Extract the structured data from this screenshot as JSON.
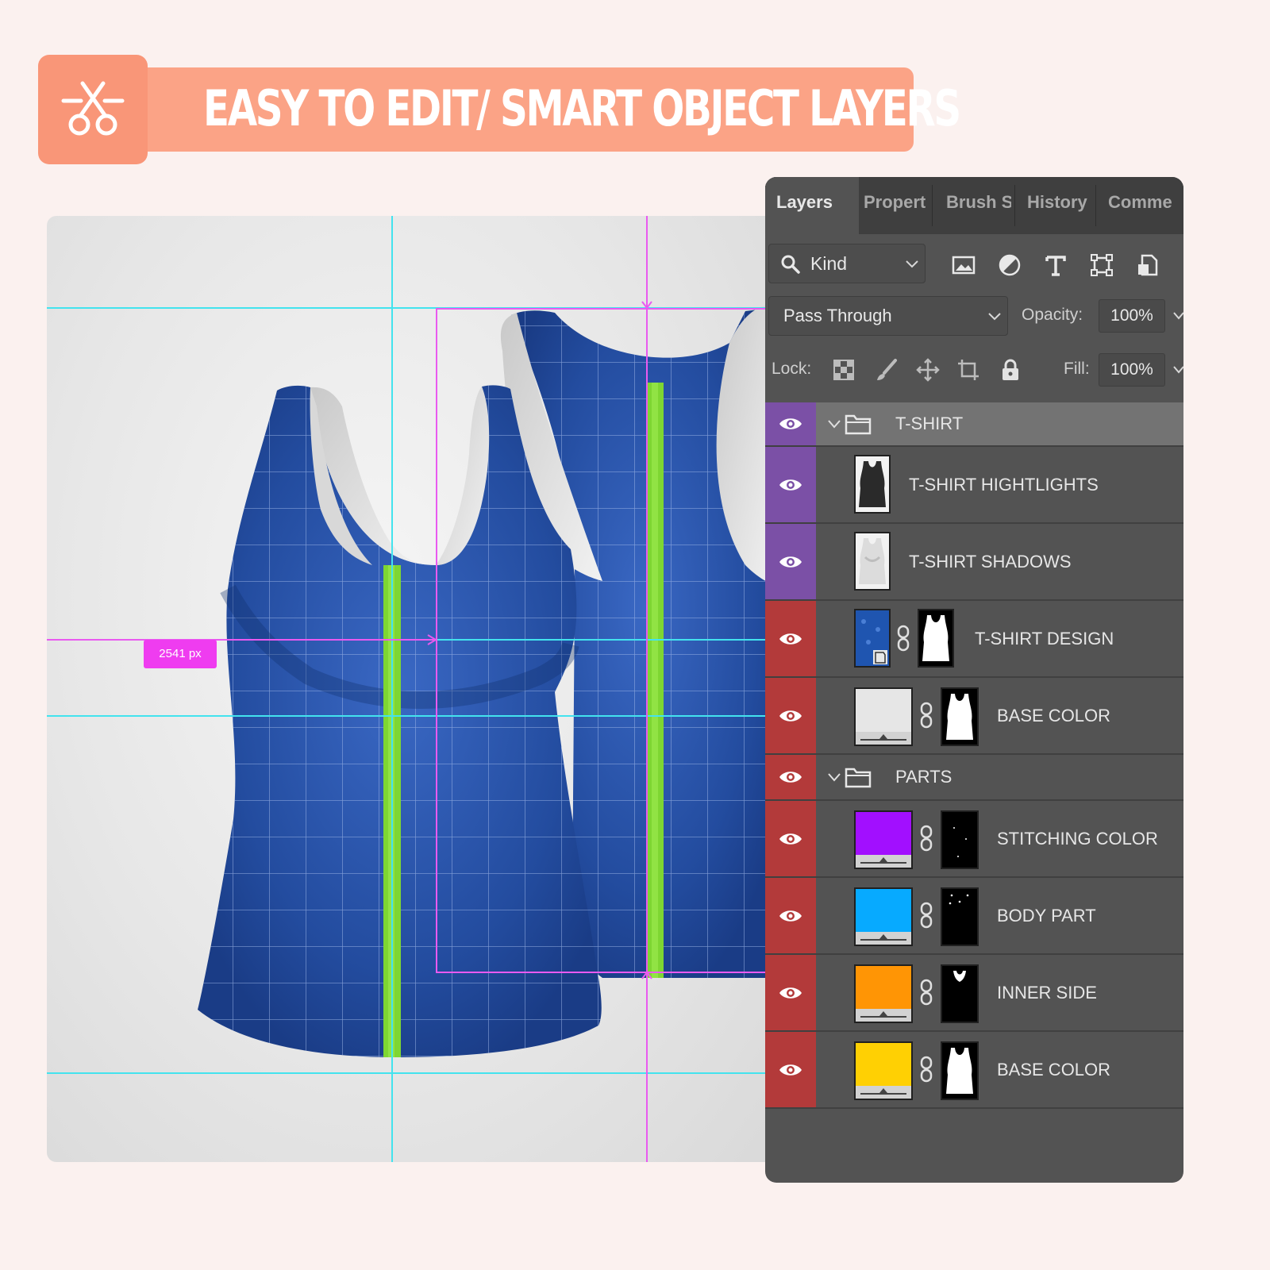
{
  "banner": {
    "title": "EASY TO EDIT/ SMART OBJECT LAYERS",
    "icon": "scissors-icon"
  },
  "canvas": {
    "measure_label": "2541 px"
  },
  "panel": {
    "tabs": [
      "Layers",
      "Propert",
      "Brush S",
      "History",
      "Comme"
    ],
    "active_tab": "Layers",
    "filter": {
      "label": "Kind"
    },
    "blend_mode": "Pass Through",
    "opacity_label": "Opacity:",
    "opacity_value": "100%",
    "lock_label": "Lock:",
    "fill_label": "Fill:",
    "fill_value": "100%"
  },
  "layers": [
    {
      "name": "T-SHIRT",
      "type": "group",
      "tag_color": "#7b50a6",
      "selected": true
    },
    {
      "name": "T-SHIRT HIGHTLIGHTS",
      "type": "layer",
      "tag_color": "#7b50a6",
      "thumb_color": "#2a2a2a"
    },
    {
      "name": "T-SHIRT SHADOWS",
      "type": "layer",
      "tag_color": "#7b50a6",
      "thumb_color": "#e8e8e8"
    },
    {
      "name": "T-SHIRT DESIGN",
      "type": "smart",
      "tag_color": "#b33a3a",
      "thumb_color": "#1f55b0"
    },
    {
      "name": "BASE COLOR",
      "type": "fill",
      "tag_color": "#b33a3a",
      "thumb_color": "#e6e6e6"
    },
    {
      "name": "PARTS",
      "type": "group",
      "tag_color": "#b33a3a"
    },
    {
      "name": "STITCHING COLOR",
      "type": "fill",
      "tag_color": "#b33a3a",
      "thumb_color": "#a20fff"
    },
    {
      "name": "BODY PART",
      "type": "fill",
      "tag_color": "#b33a3a",
      "thumb_color": "#07aaff"
    },
    {
      "name": "INNER SIDE",
      "type": "fill",
      "tag_color": "#b33a3a",
      "thumb_color": "#ff9505"
    },
    {
      "name": "BASE COLOR",
      "type": "fill",
      "tag_color": "#b33a3a",
      "thumb_color": "#ffd003"
    }
  ],
  "colors": {
    "background": "#fbf1ef",
    "banner": "#fba386",
    "shirt": "#22489a",
    "guide_cyan": "#43e3ee",
    "guide_magenta": "#e95af0",
    "center_seam": "#7ed632"
  }
}
